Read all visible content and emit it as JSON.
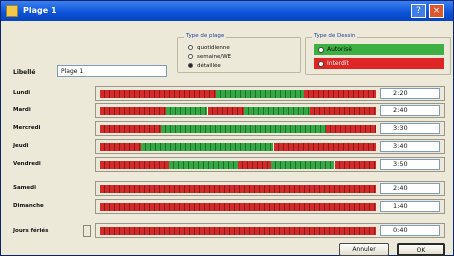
{
  "window": {
    "title": "Plage 1",
    "help": "?",
    "close": "×"
  },
  "mode_group": {
    "legend": "Type de plage",
    "options": [
      {
        "label": "quotidienne",
        "checked": false
      },
      {
        "label": "semaine/WE",
        "checked": false
      },
      {
        "label": "détaillée",
        "checked": true
      }
    ]
  },
  "type_group": {
    "legend": "Type de Dessin",
    "items": [
      {
        "label": "Autorisé",
        "color": "#3cb043"
      },
      {
        "label": "Interdit",
        "color": "#e02525"
      }
    ]
  },
  "libelle": {
    "label": "Libellé",
    "value": "Plage 1"
  },
  "colors": {
    "allowed": "#34a844",
    "forbidden": "#d42a2a"
  },
  "days": [
    {
      "label": "Lundi",
      "time": "2:20",
      "segments": [
        [
          "forbidden",
          0.42
        ],
        [
          "allowed",
          0.32
        ],
        [
          "forbidden",
          0.26
        ]
      ]
    },
    {
      "label": "Mardi",
      "time": "2:40",
      "segments": [
        [
          "forbidden",
          0.24
        ],
        [
          "allowed",
          0.15
        ],
        [
          "forbidden",
          0.13
        ],
        [
          "allowed",
          0.24
        ],
        [
          "forbidden",
          0.24
        ]
      ]
    },
    {
      "label": "Mercredi",
      "time": "3:30",
      "segments": [
        [
          "forbidden",
          0.22
        ],
        [
          "allowed",
          0.6
        ],
        [
          "forbidden",
          0.18
        ]
      ]
    },
    {
      "label": "Jeudi",
      "time": "3:40",
      "segments": [
        [
          "forbidden",
          0.15
        ],
        [
          "allowed",
          0.48
        ],
        [
          "forbidden",
          0.37
        ]
      ]
    },
    {
      "label": "Vendredi",
      "time": "3:50",
      "segments": [
        [
          "forbidden",
          0.25
        ],
        [
          "allowed",
          0.25
        ],
        [
          "forbidden",
          0.12
        ],
        [
          "allowed",
          0.23
        ],
        [
          "forbidden",
          0.15
        ]
      ]
    },
    {
      "label": "Samedi",
      "time": "2:40",
      "segments": [
        [
          "forbidden",
          1.0
        ]
      ]
    },
    {
      "label": "Dimanche",
      "time": "1:40",
      "segments": [
        [
          "forbidden",
          1.0
        ]
      ]
    },
    {
      "label": "Jours fériés",
      "time": "0:40",
      "segments": [
        [
          "forbidden",
          1.0
        ]
      ]
    }
  ],
  "buttons": {
    "cancel": "Annuler",
    "ok": "OK"
  }
}
